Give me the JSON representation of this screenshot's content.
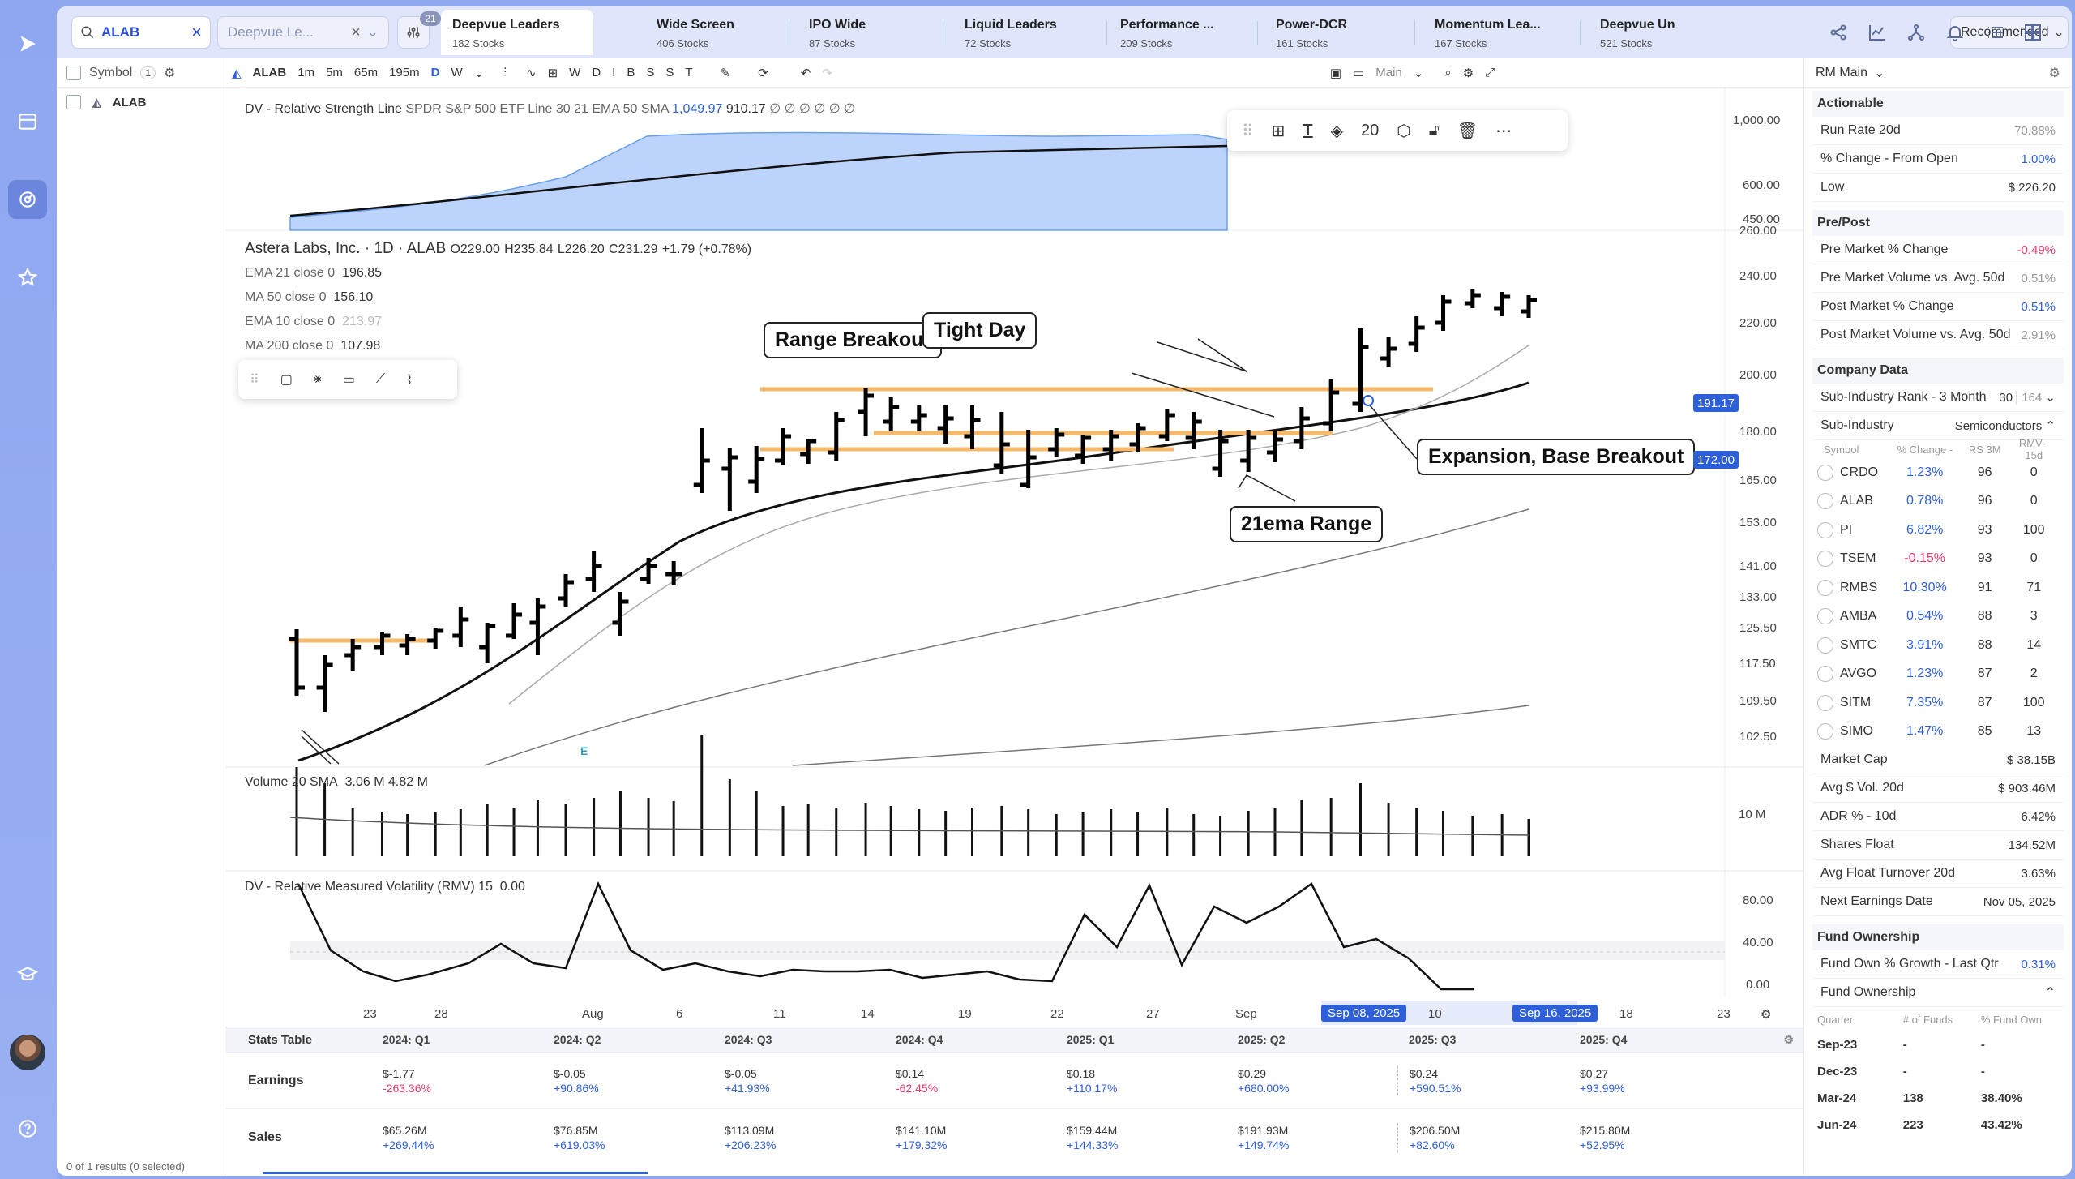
{
  "search": {
    "value": "ALAB",
    "placeholder": "Deepvue Le..."
  },
  "filter_badge": "21",
  "watchlist_tabs": [
    {
      "name": "Deepvue Leaders",
      "count": "182 Stocks"
    },
    {
      "name": "Wide Screen",
      "count": "406 Stocks"
    },
    {
      "name": "IPO Wide",
      "count": "87 Stocks"
    },
    {
      "name": "Liquid Leaders",
      "count": "72 Stocks"
    },
    {
      "name": "Performance ...",
      "count": "209 Stocks"
    },
    {
      "name": "Power-DCR",
      "count": "161 Stocks"
    },
    {
      "name": "Momentum Lea...",
      "count": "167 Stocks"
    },
    {
      "name": "Deepvue Un",
      "count": "521 Stocks"
    }
  ],
  "recommended": "Recommended",
  "left": {
    "header": "Symbol",
    "count": "1",
    "row_symbol": "ALAB",
    "footer": "0 of 1 results (0 selected)"
  },
  "toolbar": {
    "symbol": "ALAB",
    "intervals": [
      "1m",
      "5m",
      "65m",
      "195m",
      "D",
      "W"
    ],
    "letters": [
      "W",
      "D",
      "I",
      "B",
      "S",
      "S",
      "T"
    ],
    "layout": "Main"
  },
  "rsline": {
    "label": "DV - Relative Strength Line",
    "params": "SPDR S&P 500 ETF Line 30 21 EMA 50 SMA",
    "v1": "1,049.97",
    "v2": "910.17",
    "dots": "∅ ∅ ∅ ∅ ∅ ∅",
    "ticks": [
      "1,000.00",
      "600.00",
      "450.00"
    ]
  },
  "ohlc": {
    "name": "Astera Labs, Inc. · 1D · ALAB",
    "o": "O229.00",
    "h": "H235.84",
    "l": "L226.20",
    "c": "C231.29",
    "chg": "+1.79 (+0.78%)"
  },
  "mas": [
    {
      "label": "EMA 21 close 0",
      "value": "196.85"
    },
    {
      "label": "MA 50 close 0",
      "value": "156.10"
    },
    {
      "label": "EMA 10 close 0",
      "value": "213.97"
    },
    {
      "label": "MA 200 close 0",
      "value": "107.98"
    }
  ],
  "price_ticks": [
    "260.00",
    "240.00",
    "220.00",
    "200.00",
    "180.00",
    "165.00",
    "153.00",
    "141.00",
    "133.00",
    "125.50",
    "117.50",
    "109.50",
    "102.50"
  ],
  "price_tags": [
    "191.17",
    "172.00"
  ],
  "float_size": "20",
  "callouts": {
    "range": "Range Breakout",
    "tight": "Tight Day",
    "expansion": "Expansion, Base Breakout",
    "ema": "21ema Range"
  },
  "earn_marker": "E",
  "volume": {
    "label": "Volume 20 SMA",
    "v1": "3.06 M",
    "v2": "4.82 M",
    "tick": "10 M"
  },
  "rmv": {
    "label": "DV - Relative Measured Volatility (RMV)",
    "period": "15",
    "value": "0.00",
    "ticks": [
      "80.00",
      "40.00",
      "0.00"
    ]
  },
  "dates": [
    "23",
    "28",
    "Aug",
    "6",
    "11",
    "14",
    "19",
    "22",
    "27",
    "Sep",
    "10",
    "18",
    "23"
  ],
  "date_sel": [
    "Sep 08, 2025",
    "Sep 16, 2025"
  ],
  "stats": {
    "title": "Stats Table",
    "quarters": [
      "2024: Q1",
      "2024: Q2",
      "2024: Q3",
      "2024: Q4",
      "2025: Q1",
      "2025: Q2",
      "2025: Q3",
      "2025: Q4"
    ],
    "earnings_label": "Earnings",
    "earnings": [
      [
        "$-1.77",
        "-263.36%"
      ],
      [
        "$-0.05",
        "+90.86%"
      ],
      [
        "$-0.05",
        "+41.93%"
      ],
      [
        "$0.14",
        "-62.45%"
      ],
      [
        "$0.18",
        "+110.17%"
      ],
      [
        "$0.29",
        "+680.00%"
      ],
      [
        "$0.24",
        "+590.51%"
      ],
      [
        "$0.27",
        "+93.99%"
      ]
    ],
    "sales_label": "Sales",
    "sales": [
      [
        "$65.26M",
        "+269.44%"
      ],
      [
        "$76.85M",
        "+619.03%"
      ],
      [
        "$113.09M",
        "+206.23%"
      ],
      [
        "$141.10M",
        "+179.32%"
      ],
      [
        "$159.44M",
        "+144.33%"
      ],
      [
        "$191.93M",
        "+149.74%"
      ],
      [
        "$206.50M",
        "+82.60%"
      ],
      [
        "$215.80M",
        "+52.95%"
      ]
    ]
  },
  "right": {
    "title": "RM Main",
    "actionable": {
      "title": "Actionable",
      "rows": [
        [
          "Run Rate 20d",
          "70.88%"
        ],
        [
          "% Change - From Open",
          "1.00%"
        ],
        [
          "Low",
          "$ 226.20"
        ]
      ]
    },
    "prepost": {
      "title": "Pre/Post",
      "rows": [
        [
          "Pre Market % Change",
          "-0.49%"
        ],
        [
          "Pre Market Volume vs. Avg. 50d",
          "0.51%"
        ],
        [
          "Post Market % Change",
          "0.51%"
        ],
        [
          "Post Market Volume vs. Avg. 50d",
          "2.91%"
        ]
      ]
    },
    "company": {
      "title": "Company Data",
      "rank_label": "Sub-Industry Rank - 3 Month",
      "rank": "30",
      "rank_of": "164",
      "subind_label": "Sub-Industry",
      "subind": "Semiconductors",
      "cols": [
        "Symbol",
        "% Change -",
        "RS 3M",
        "RMV - 15d"
      ],
      "peers": [
        [
          "CRDO",
          "1.23%",
          "96",
          "0"
        ],
        [
          "ALAB",
          "0.78%",
          "96",
          "0"
        ],
        [
          "PI",
          "6.82%",
          "93",
          "100"
        ],
        [
          "TSEM",
          "-0.15%",
          "93",
          "0"
        ],
        [
          "RMBS",
          "10.30%",
          "91",
          "71"
        ],
        [
          "AMBA",
          "0.54%",
          "88",
          "3"
        ],
        [
          "SMTC",
          "3.91%",
          "88",
          "14"
        ],
        [
          "AVGO",
          "1.23%",
          "87",
          "2"
        ],
        [
          "SITM",
          "7.35%",
          "87",
          "100"
        ],
        [
          "SIMO",
          "1.47%",
          "85",
          "13"
        ]
      ],
      "rows": [
        [
          "Market Cap",
          "$ 38.15B"
        ],
        [
          "Avg $ Vol. 20d",
          "$ 903.46M"
        ],
        [
          "ADR % - 10d",
          "6.42%"
        ],
        [
          "Shares Float",
          "134.52M"
        ],
        [
          "Avg Float Turnover 20d",
          "3.63%"
        ],
        [
          "Next Earnings Date",
          "Nov 05, 2025"
        ]
      ]
    },
    "fund": {
      "title": "Fund Ownership",
      "growth_label": "Fund Own % Growth - Last Qtr",
      "growth": "0.31%",
      "sub": "Fund Ownership",
      "cols": [
        "Quarter",
        "# of Funds",
        "% Fund Own"
      ],
      "rows": [
        [
          "Sep-23",
          "-",
          "-"
        ],
        [
          "Dec-23",
          "-",
          "-"
        ],
        [
          "Mar-24",
          "138",
          "38.40%"
        ],
        [
          "Jun-24",
          "223",
          "43.42%"
        ]
      ]
    }
  },
  "colors": {
    "accent": "#2d5fd8",
    "negative": "#e5386d",
    "rail": "#8fa8ee"
  }
}
